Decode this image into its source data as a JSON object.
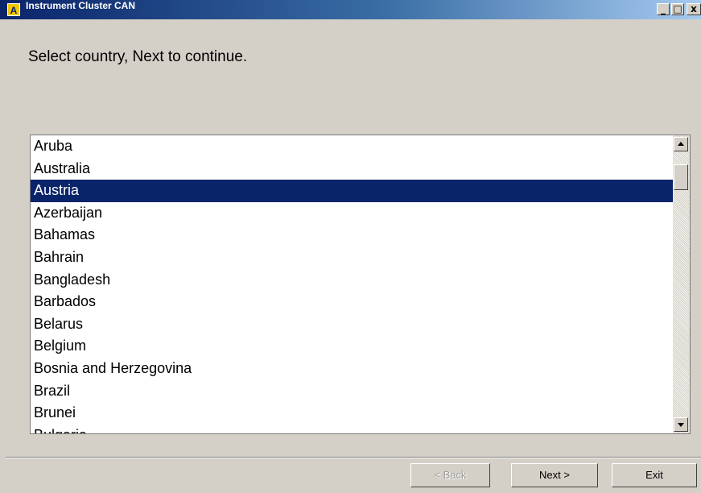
{
  "window": {
    "title": "Instrument Cluster CAN",
    "icon_letter": "A",
    "min_glyph": "_",
    "max_glyph": "□",
    "close_glyph": "x"
  },
  "instruction": "Select country, Next to continue.",
  "countries": [
    "Aruba",
    "Australia",
    "Austria",
    "Azerbaijan",
    "Bahamas",
    "Bahrain",
    "Bangladesh",
    "Barbados",
    "Belarus",
    "Belgium",
    "Bosnia and Herzegovina",
    "Brazil",
    "Brunei",
    "Bulgaria"
  ],
  "selected_country": "Austria",
  "buttons": {
    "back": "< Back",
    "next": "Next >",
    "exit": "Exit"
  },
  "colors": {
    "selection": "#0a246a",
    "title_bar": "#0a246a"
  }
}
